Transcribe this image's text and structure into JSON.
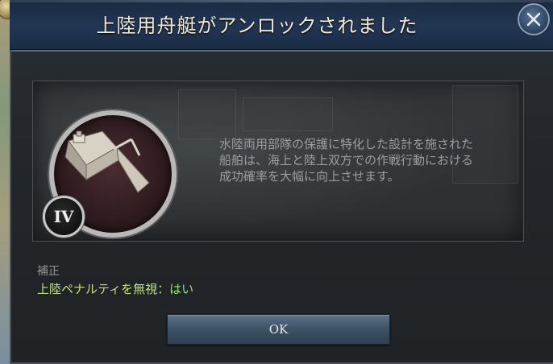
{
  "dialog": {
    "title": "上陸用舟艇がアンロックされました",
    "close_icon": "close-icon",
    "description": "水陸両用部隊の保護に特化した設計を施された\n船舶は、海上と陸上双方での作戦行動における\n成功確率を大幅に向上させます。",
    "tech_icon": "landing-craft-icon",
    "rank": "IV",
    "bonus": {
      "header": "補正",
      "name": "上陸ペナルティを無視",
      "separator": "：",
      "value": "はい"
    },
    "ok_label": "OK"
  },
  "colors": {
    "title_bar": "#223654",
    "bonus_text": "#bfe07a",
    "button": "#3f5468"
  }
}
